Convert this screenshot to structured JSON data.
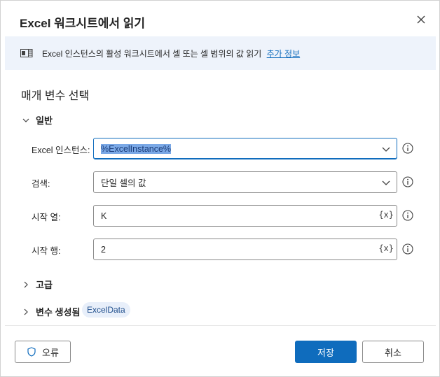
{
  "dialog": {
    "title": "Excel 워크시트에서 읽기",
    "close_label": "×"
  },
  "info": {
    "text": "Excel 인스턴스의 활성 워크시트에서 셀 또는 셀 범위의 값 읽기",
    "link": "추가 정보"
  },
  "section": {
    "title": "매개 변수 선택"
  },
  "general": {
    "header": "일반",
    "fields": [
      {
        "label": "Excel 인스턴스:",
        "value": "%ExcelInstance%"
      },
      {
        "label": "검색:",
        "value": "단일 셀의 값"
      },
      {
        "label": "시작 열:",
        "value": "K",
        "var_button": "{x}"
      },
      {
        "label": "시작 행:",
        "value": "2",
        "var_button": "{x}"
      }
    ]
  },
  "advanced": {
    "header": "고급"
  },
  "variables": {
    "header": "변수 생성됨",
    "chip": "ExcelData"
  },
  "footer": {
    "error_label": "오류",
    "save_label": "저장",
    "cancel_label": "취소"
  },
  "colors": {
    "accent": "#0f6cbd",
    "info_bg": "#eef3fb",
    "chip_bg": "#e8effa"
  },
  "icons": {
    "close": "close-icon",
    "info": "excel-sheet-icon",
    "collapse": "chevron-down-icon",
    "expand": "chevron-right-icon",
    "dropdown": "chevron-down-icon",
    "help": "info-circle-icon",
    "error": "shield-icon"
  }
}
